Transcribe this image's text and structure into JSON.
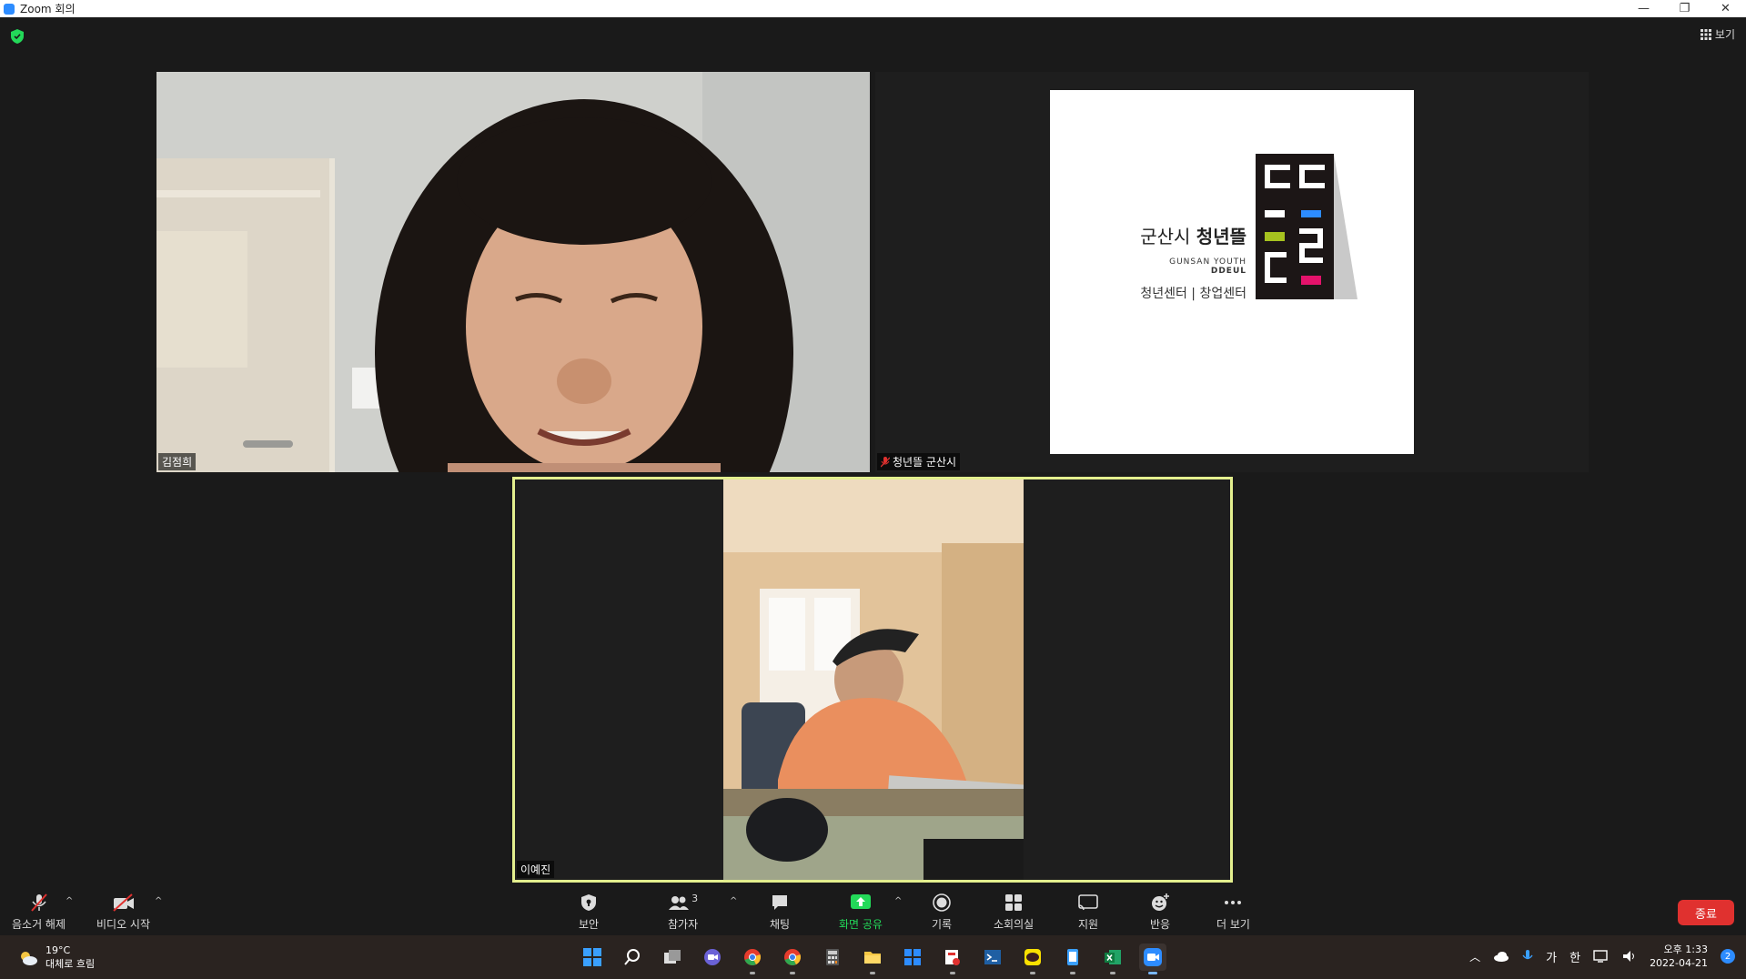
{
  "window": {
    "title": "Zoom 회의",
    "controls": [
      "—",
      "❐",
      "✕"
    ]
  },
  "top": {
    "view_label": "보기"
  },
  "participants": [
    {
      "name": "김점희",
      "muted": false
    },
    {
      "name": "청년뜰 군산시",
      "muted": true
    },
    {
      "name": "이예진",
      "muted": false,
      "active_speaker": true
    }
  ],
  "logo": {
    "title_regular": "군산시 ",
    "title_bold": "청년뜰",
    "sub1": "GUNSAN YOUTH",
    "sub2": "DDEUL",
    "sub3a": "청년센터",
    "sub3b": "창업센터"
  },
  "toolbar": {
    "unmute_label": "음소거 해제",
    "video_label": "비디오 시작",
    "security_label": "보안",
    "participants_label": "참가자",
    "participants_count": "3",
    "chat_label": "채팅",
    "share_label": "화면 공유",
    "record_label": "기록",
    "breakout_label": "소회의실",
    "support_label": "지원",
    "reactions_label": "반응",
    "more_label": "더 보기",
    "end_label": "종료"
  },
  "taskbar": {
    "weather_temp": "19°C",
    "weather_desc": "대체로 흐림",
    "ime_1": "가",
    "ime_2": "한",
    "time": "오후 1:33",
    "date": "2022-04-21",
    "notifications": "2"
  },
  "colors": {
    "active_border": "#e3ef8e",
    "share_green": "#23d959",
    "end_red": "#e0312f"
  }
}
